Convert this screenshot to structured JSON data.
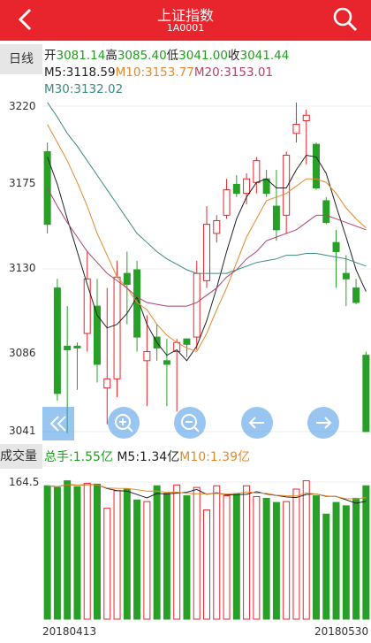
{
  "header": {
    "title": "上证指数",
    "code": "1A0001"
  },
  "period_tab": "日线",
  "ohlc": {
    "open_label": "开",
    "open": "3081.14",
    "high_label": "高",
    "high": "3085.40",
    "low_label": "低",
    "low": "3041.00",
    "close_label": "收",
    "close": "3041.44"
  },
  "ma": {
    "ma5": "M5:3118.59",
    "ma10": "M10:3153.77",
    "ma20": "M20:3153.01",
    "ma30": "M30:3132.02"
  },
  "y_labels": [
    "3220",
    "3175",
    "3130",
    "3086",
    "3041"
  ],
  "volume": {
    "tab": "成交量",
    "total_label": "总手:",
    "total": "1.55亿",
    "ma5": "M5:1.34亿",
    "ma10": "M10:1.39亿",
    "max_label": "164.5"
  },
  "dates": {
    "start": "20180413",
    "end": "20180530"
  },
  "colors": {
    "header": "#e8242c",
    "up": "#e8242c",
    "down": "#28a028"
  },
  "chart_data": {
    "type": "candlestick",
    "ylim": [
      3041,
      3220
    ],
    "candles": [
      {
        "o": 3195,
        "h": 3200,
        "l": 3150,
        "c": 3155
      },
      {
        "o": 3120,
        "h": 3125,
        "l": 3058,
        "c": 3062
      },
      {
        "o": 3088,
        "h": 3110,
        "l": 3040,
        "c": 3086
      },
      {
        "o": 3088,
        "h": 3090,
        "l": 3064,
        "c": 3087
      },
      {
        "o": 3095,
        "h": 3140,
        "l": 3085,
        "c": 3125
      },
      {
        "o": 3110,
        "h": 3125,
        "l": 3068,
        "c": 3078
      },
      {
        "o": 3065,
        "h": 3120,
        "l": 3045,
        "c": 3070
      },
      {
        "o": 3070,
        "h": 3135,
        "l": 3060,
        "c": 3126
      },
      {
        "o": 3128,
        "h": 3140,
        "l": 3100,
        "c": 3122
      },
      {
        "o": 3130,
        "h": 3135,
        "l": 3085,
        "c": 3093
      },
      {
        "o": 3080,
        "h": 3105,
        "l": 3055,
        "c": 3085
      },
      {
        "o": 3093,
        "h": 3100,
        "l": 3080,
        "c": 3087
      },
      {
        "o": 3080,
        "h": 3092,
        "l": 3055,
        "c": 3078
      },
      {
        "o": 3085,
        "h": 3092,
        "l": 3052,
        "c": 3090
      },
      {
        "o": 3092,
        "h": 3090,
        "l": 3082,
        "c": 3089
      },
      {
        "o": 3093,
        "h": 3135,
        "l": 3086,
        "c": 3128
      },
      {
        "o": 3124,
        "h": 3165,
        "l": 3120,
        "c": 3155
      },
      {
        "o": 3150,
        "h": 3160,
        "l": 3145,
        "c": 3157
      },
      {
        "o": 3160,
        "h": 3180,
        "l": 3158,
        "c": 3174
      },
      {
        "o": 3177,
        "h": 3182,
        "l": 3170,
        "c": 3172
      },
      {
        "o": 3172,
        "h": 3183,
        "l": 3166,
        "c": 3180
      },
      {
        "o": 3178,
        "h": 3192,
        "l": 3172,
        "c": 3190
      },
      {
        "o": 3180,
        "h": 3185,
        "l": 3170,
        "c": 3172
      },
      {
        "o": 3165,
        "h": 3185,
        "l": 3146,
        "c": 3152
      },
      {
        "o": 3160,
        "h": 3195,
        "l": 3150,
        "c": 3193
      },
      {
        "o": 3205,
        "h": 3222,
        "l": 3200,
        "c": 3210
      },
      {
        "o": 3212,
        "h": 3218,
        "l": 3188,
        "c": 3215
      },
      {
        "o": 3199,
        "h": 3200,
        "l": 3174,
        "c": 3175
      },
      {
        "o": 3168,
        "h": 3170,
        "l": 3155,
        "c": 3156
      },
      {
        "o": 3145,
        "h": 3152,
        "l": 3120,
        "c": 3140
      },
      {
        "o": 3128,
        "h": 3138,
        "l": 3110,
        "c": 3125
      },
      {
        "o": 3120,
        "h": 3125,
        "l": 3111,
        "c": 3112
      },
      {
        "o": 3083,
        "h": 3085,
        "l": 3041,
        "c": 3041
      }
    ],
    "ma5": [
      3192,
      3177,
      3158,
      3140,
      3122,
      3105,
      3098,
      3100,
      3106,
      3115,
      3100,
      3090,
      3083,
      3086,
      3080,
      3088,
      3102,
      3120,
      3140,
      3158,
      3170,
      3178,
      3180,
      3175,
      3175,
      3185,
      3193,
      3192,
      3183,
      3165,
      3148,
      3130,
      3118
    ],
    "ma10": [
      3210,
      3200,
      3190,
      3178,
      3165,
      3150,
      3138,
      3126,
      3120,
      3112,
      3108,
      3100,
      3094,
      3090,
      3087,
      3085,
      3095,
      3108,
      3120,
      3134,
      3148,
      3158,
      3168,
      3170,
      3172,
      3176,
      3180,
      3180,
      3178,
      3172,
      3164,
      3158,
      3153
    ],
    "ma20": [
      3175,
      3165,
      3156,
      3148,
      3140,
      3134,
      3128,
      3124,
      3120,
      3115,
      3112,
      3111,
      3110,
      3110,
      3110,
      3112,
      3116,
      3120,
      3126,
      3130,
      3136,
      3140,
      3146,
      3148,
      3150,
      3152,
      3156,
      3160,
      3160,
      3158,
      3156,
      3154,
      3152
    ],
    "ma30": [
      3222,
      3214,
      3205,
      3198,
      3190,
      3182,
      3174,
      3166,
      3158,
      3150,
      3145,
      3140,
      3136,
      3133,
      3130,
      3128,
      3128,
      3128,
      3128,
      3130,
      3132,
      3134,
      3135,
      3136,
      3138,
      3138,
      3139,
      3139,
      3138,
      3137,
      3136,
      3134,
      3132
    ],
    "volume": [
      160,
      158,
      166,
      159,
      163,
      162,
      133,
      154,
      156,
      143,
      141,
      160,
      151,
      161,
      148,
      158,
      131,
      160,
      148,
      150,
      160,
      147,
      145,
      140,
      141,
      156,
      166,
      148,
      126,
      140,
      136,
      145,
      160
    ],
    "volume_max": 164.5
  }
}
